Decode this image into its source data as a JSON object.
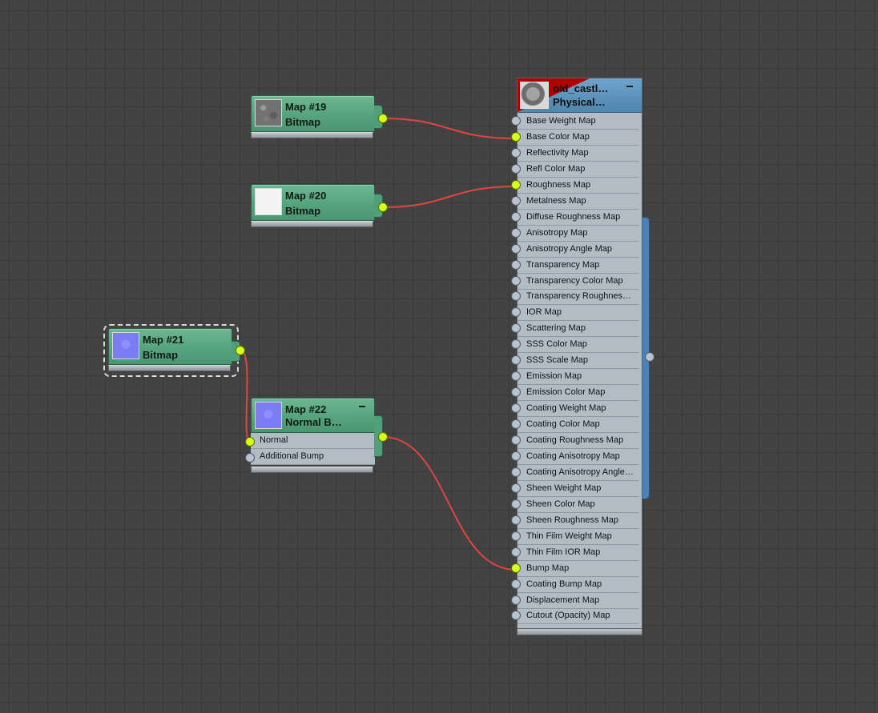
{
  "nodes": {
    "map19": {
      "title": "Map #19",
      "subtitle": "Bitmap",
      "thumb": "rock-texture"
    },
    "map20": {
      "title": "Map #20",
      "subtitle": "Bitmap",
      "thumb": "white-texture"
    },
    "map21": {
      "title": "Map #21",
      "subtitle": "Bitmap",
      "thumb": "normal-texture",
      "selected": true
    },
    "map22": {
      "title": "Map #22",
      "subtitle": "Normal  B…",
      "thumb": "normal-texture",
      "ports": [
        "Normal",
        "Additional Bump"
      ]
    }
  },
  "material": {
    "name_line1": "old_castl…",
    "name_line2": "Physical…",
    "ports": [
      "Base Weight Map",
      "Base Color Map",
      "Reflectivity Map",
      "Refl Color Map",
      "Roughness Map",
      "Metalness Map",
      "Diffuse Roughness Map",
      "Anisotropy Map",
      "Anisotropy Angle Map",
      "Transparency Map",
      "Transparency Color Map",
      "Transparency Roughnes…",
      "IOR Map",
      "Scattering Map",
      "SSS Color Map",
      "SSS Scale Map",
      "Emission Map",
      "Emission Color Map",
      "Coating Weight Map",
      "Coating Color Map",
      "Coating Roughness Map",
      "Coating Anisotropy Map",
      "Coating Anisotropy Angle…",
      "Sheen Weight Map",
      "Sheen Color Map",
      "Sheen Roughness Map",
      "Thin Film Weight Map",
      "Thin Film IOR Map",
      "Bump Map",
      "Coating Bump Map",
      "Displacement Map",
      "Cutout (Opacity) Map"
    ],
    "connected_ports": [
      "Base Color Map",
      "Roughness Map",
      "Bump Map"
    ]
  },
  "connections": [
    {
      "from": "Map #19",
      "to": "Base Color Map"
    },
    {
      "from": "Map #20",
      "to": "Roughness Map"
    },
    {
      "from": "Map #21",
      "to": "Normal"
    },
    {
      "from": "Map #22",
      "to": "Bump Map"
    }
  ],
  "colors": {
    "canvas": "#434343",
    "wire": "#e0463f",
    "socket_connected": "#d6ff1c",
    "socket_empty": "#b9c3cf",
    "map_node": "#56a47e",
    "material_header": "#5f95bf",
    "warning": "#b00000"
  }
}
